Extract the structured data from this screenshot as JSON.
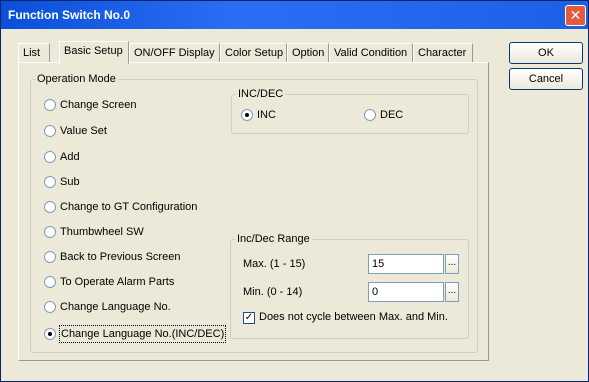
{
  "window": {
    "title": "Function Switch No.0",
    "close_glyph": "✕"
  },
  "tabs": [
    {
      "label": "List"
    },
    {
      "label": "Basic Setup"
    },
    {
      "label": "ON/OFF Display"
    },
    {
      "label": "Color Setup"
    },
    {
      "label": "Option"
    },
    {
      "label": "Valid Condition"
    },
    {
      "label": "Character"
    }
  ],
  "selected_tab": "Basic Setup",
  "buttons": {
    "ok": "OK",
    "cancel": "Cancel"
  },
  "operation_mode": {
    "legend": "Operation Mode",
    "selected": "Change Language No.(INC/DEC)",
    "options": [
      {
        "label": "Change Screen"
      },
      {
        "label": "Value Set"
      },
      {
        "label": "Add"
      },
      {
        "label": "Sub"
      },
      {
        "label": "Change to GT Configuration"
      },
      {
        "label": "Thumbwheel SW"
      },
      {
        "label": "Back to Previous Screen"
      },
      {
        "label": "To Operate Alarm Parts"
      },
      {
        "label": "Change Language No."
      },
      {
        "label": "Change Language No.(INC/DEC)"
      }
    ]
  },
  "inc_dec": {
    "legend": "INC/DEC",
    "selected": "INC",
    "options": [
      {
        "label": "INC"
      },
      {
        "label": "DEC"
      }
    ]
  },
  "inc_dec_range": {
    "legend": "Inc/Dec Range",
    "max_label": "Max.  (1 - 15)",
    "max_value": "15",
    "min_label": "Min.  (0 - 14)",
    "min_value": "0",
    "browse_glyph": "...",
    "no_cycle_label": "Does not cycle between Max. and Min.",
    "no_cycle_checked": true,
    "check_glyph": "✓"
  }
}
